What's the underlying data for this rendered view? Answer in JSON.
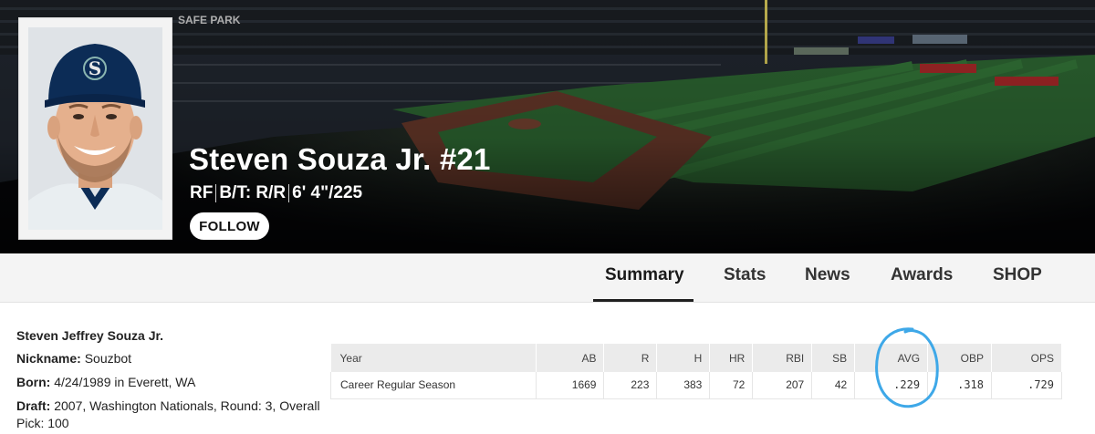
{
  "colors": {
    "accent_annotation": "#3ea8e8",
    "hero_dark": "#07080b",
    "tabbar_bg": "#f4f4f4",
    "table_header_bg": "#ebebeb",
    "field_grass": "#2f6b34"
  },
  "player": {
    "name_number": "Steven Souza Jr. #21",
    "position": "RF",
    "bats_throws": "B/T: R/R",
    "height_weight": "6' 4\"/225",
    "follow_label": "FOLLOW"
  },
  "tabs": [
    {
      "label": "Summary",
      "active": true
    },
    {
      "label": "Stats",
      "active": false
    },
    {
      "label": "News",
      "active": false
    },
    {
      "label": "Awards",
      "active": false
    },
    {
      "label": "SHOP",
      "active": false
    }
  ],
  "bio": {
    "full_name": "Steven Jeffrey Souza Jr.",
    "nickname_label": "Nickname:",
    "nickname": "Souzbot",
    "born_label": "Born:",
    "born": "4/24/1989 in Everett, WA",
    "draft_label": "Draft:",
    "draft": "2007, Washington Nationals, Round: 3, Overall Pick: 100"
  },
  "stats_table": {
    "headers": [
      "Year",
      "AB",
      "R",
      "H",
      "HR",
      "RBI",
      "SB",
      "AVG",
      "OBP",
      "OPS"
    ],
    "rows": [
      [
        "Career Regular Season",
        "1669",
        "223",
        "383",
        "72",
        "207",
        "42",
        ".229",
        ".318",
        ".729"
      ]
    ]
  },
  "icons": {
    "team_cap_logo": "mariners-compass-logo-icon",
    "annotation": "hand-drawn-circle-highlight"
  }
}
